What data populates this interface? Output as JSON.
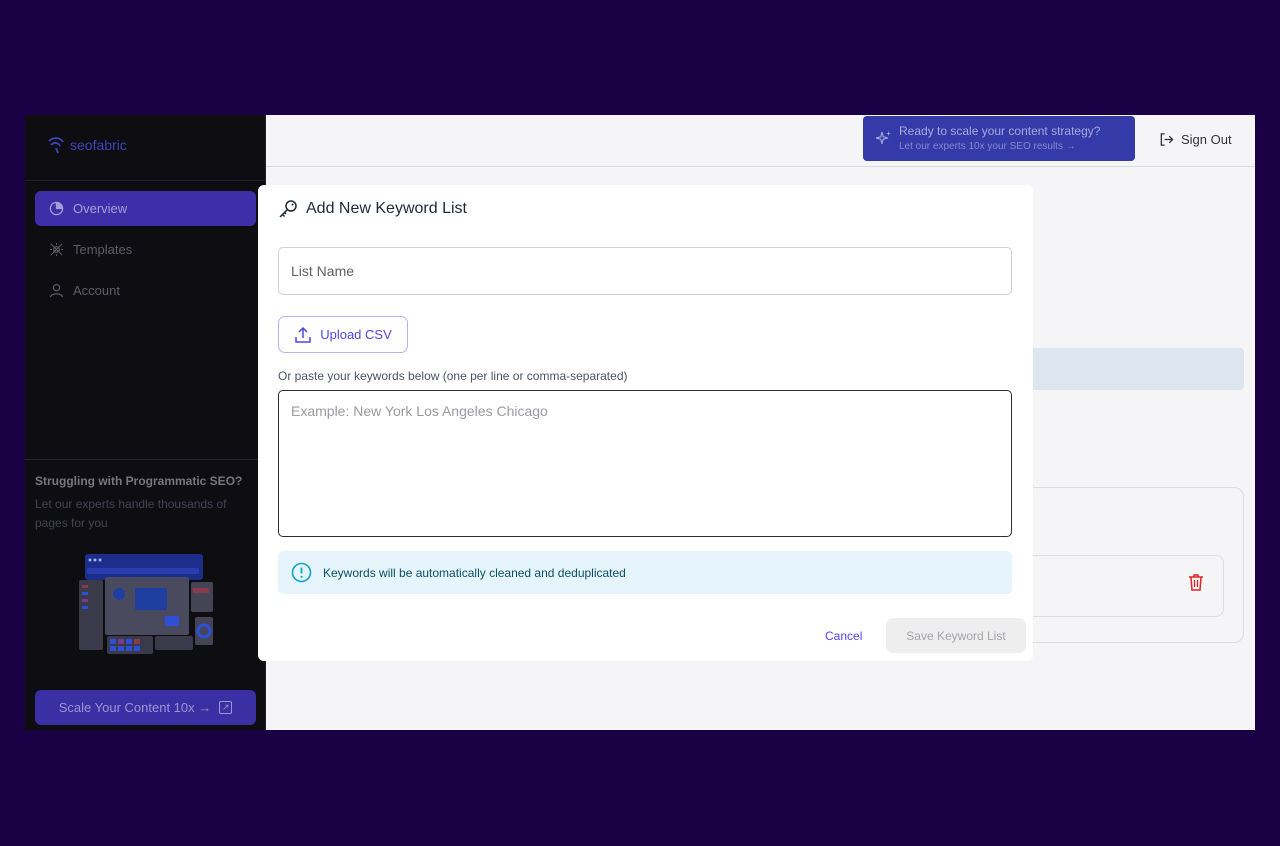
{
  "brand": {
    "name": "seofabric"
  },
  "sidebar": {
    "items": [
      {
        "label": "Overview",
        "icon": "pie-chart-icon",
        "active": true
      },
      {
        "label": "Templates",
        "icon": "sparkle-cross-icon",
        "active": false
      },
      {
        "label": "Account",
        "icon": "user-icon",
        "active": false
      }
    ],
    "promo": {
      "title": "Struggling with Programmatic SEO?",
      "text": "Let our experts handle thousands of pages for you",
      "button_label": "Scale Your Content 10x →"
    }
  },
  "header": {
    "cta_title": "Ready to scale your content strategy?",
    "cta_subtitle": "Let our experts 10x your SEO results →",
    "signout_label": "Sign Out"
  },
  "modal": {
    "title": "Add New Keyword List",
    "list_name_placeholder": "List Name",
    "upload_label": "Upload CSV",
    "paste_label": "Or paste your keywords below (one per line or comma-separated)",
    "keywords_placeholder": "Example: New York Los Angeles Chicago",
    "info_text": "Keywords will be automatically cleaned and deduplicated",
    "cancel_label": "Cancel",
    "save_label": "Save Keyword List"
  },
  "colors": {
    "page_bg": "#1a0044",
    "accent": "#4f46e5",
    "sidebar_bg": "#0d0d12",
    "info_bg": "#e6f5fc",
    "danger": "#dc2626"
  }
}
